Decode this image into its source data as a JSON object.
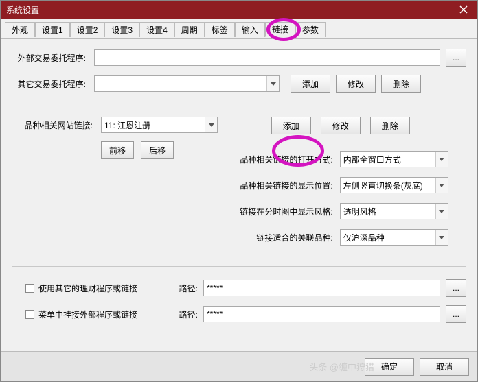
{
  "title": "系统设置",
  "tabs": [
    "外观",
    "设置1",
    "设置2",
    "设置3",
    "设置4",
    "周期",
    "标签",
    "输入",
    "链接",
    "参数"
  ],
  "active_tab": 8,
  "section1": {
    "row1_label": "外部交易委托程序:",
    "row1_value": "",
    "browse": "...",
    "row2_label": "其它交易委托程序:",
    "row2_value": "",
    "add": "添加",
    "modify": "修改",
    "delete": "删除"
  },
  "section2": {
    "label": "品种相关网站链接:",
    "combo_value": "11: 江恩注册",
    "add": "添加",
    "modify": "修改",
    "delete": "删除",
    "prev": "前移",
    "next": "后移",
    "opts": [
      {
        "label": "品种相关链接的打开方式:",
        "value": "内部全窗口方式"
      },
      {
        "label": "品种相关链接的显示位置:",
        "value": "左侧竖直切换条(灰底)"
      },
      {
        "label": "链接在分时图中显示风格:",
        "value": "透明风格"
      },
      {
        "label": "链接适合的关联品种:",
        "value": "仅沪深品种"
      }
    ]
  },
  "section3": {
    "chk1": "使用其它的理财程序或链接",
    "chk2": "菜单中挂接外部程序或链接",
    "path_label": "路径:",
    "path_value": "*****",
    "browse": "..."
  },
  "footer": {
    "ok": "确定",
    "cancel": "取消"
  },
  "watermark": "头条 @缠中狩猎"
}
